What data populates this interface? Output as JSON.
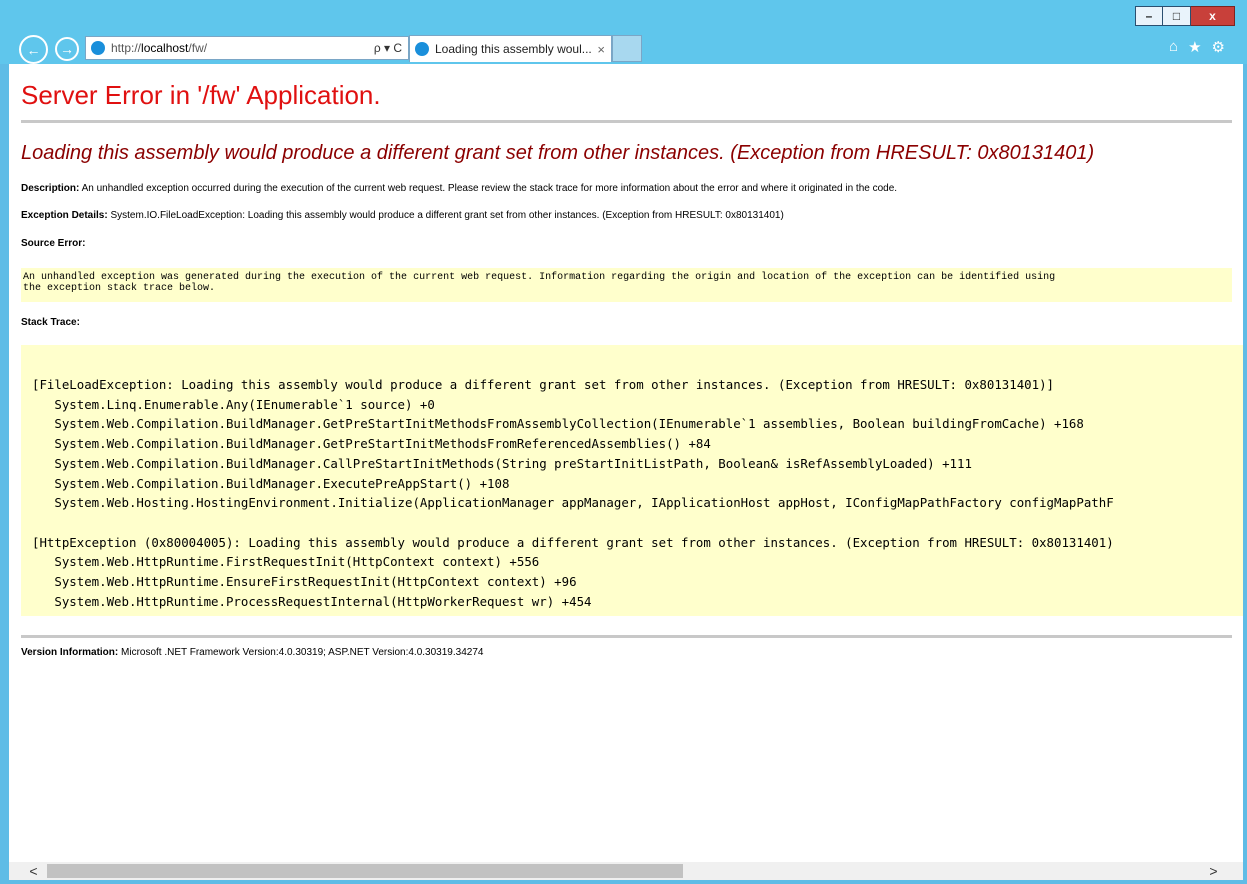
{
  "browser": {
    "address": {
      "prefix": "http://",
      "host": "localhost",
      "path": "/fw/",
      "tools": "ρ ▾ C"
    },
    "tab": {
      "title": "Loading this assembly woul...",
      "close": "×"
    },
    "window_buttons": {
      "minimize": "–",
      "restore": "□",
      "close": "x"
    },
    "nav": {
      "back": "←",
      "forward": "→"
    },
    "toolbar_icons": {
      "home": "⌂",
      "favorites": "★",
      "tools": "⚙"
    }
  },
  "page": {
    "title": "Server Error in '/fw' Application.",
    "error_heading": "Loading this assembly would produce a different grant set from other instances. (Exception from HRESULT: 0x80131401)",
    "description_label": "Description:",
    "description_text": "An unhandled exception occurred during the execution of the current web request. Please review the stack trace for more information about the error and where it originated in the code.",
    "exception_label": "Exception Details:",
    "exception_text": "System.IO.FileLoadException: Loading this assembly would produce a different grant set from other instances. (Exception from HRESULT: 0x80131401)",
    "source_error_label": "Source Error:",
    "source_error_text": "An unhandled exception was generated during the execution of the current web request. Information regarding the origin and location of the exception can be identified using\nthe exception stack trace below.",
    "stack_trace_label": "Stack Trace:",
    "stack_trace_text": "[FileLoadException: Loading this assembly would produce a different grant set from other instances. (Exception from HRESULT: 0x80131401)]\n   System.Linq.Enumerable.Any(IEnumerable`1 source) +0\n   System.Web.Compilation.BuildManager.GetPreStartInitMethodsFromAssemblyCollection(IEnumerable`1 assemblies, Boolean buildingFromCache) +168\n   System.Web.Compilation.BuildManager.GetPreStartInitMethodsFromReferencedAssemblies() +84\n   System.Web.Compilation.BuildManager.CallPreStartInitMethods(String preStartInitListPath, Boolean& isRefAssemblyLoaded) +111\n   System.Web.Compilation.BuildManager.ExecutePreAppStart() +108\n   System.Web.Hosting.HostingEnvironment.Initialize(ApplicationManager appManager, IApplicationHost appHost, IConfigMapPathFactory configMapPathF\n\n[HttpException (0x80004005): Loading this assembly would produce a different grant set from other instances. (Exception from HRESULT: 0x80131401)\n   System.Web.HttpRuntime.FirstRequestInit(HttpContext context) +556\n   System.Web.HttpRuntime.EnsureFirstRequestInit(HttpContext context) +96\n   System.Web.HttpRuntime.ProcessRequestInternal(HttpWorkerRequest wr) +454",
    "version_label": "Version Information:",
    "version_text": "Microsoft .NET Framework Version:4.0.30319; ASP.NET Version:4.0.30319.34274"
  },
  "scrollbar": {
    "left": "<",
    "right": ">"
  }
}
